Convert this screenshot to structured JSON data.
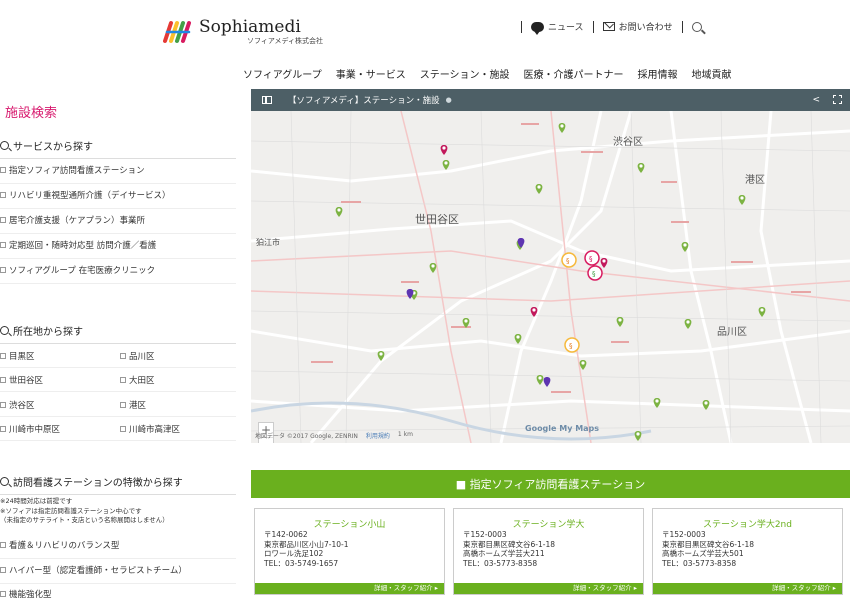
{
  "brand": {
    "name": "Sophiamedi",
    "sub": "ソフィアメディ株式会社"
  },
  "topnav": {
    "news": "ニュース",
    "contact": "お問い合わせ"
  },
  "mainnav": [
    "ソフィアグループ",
    "事業・サービス",
    "ステーション・施設",
    "医療・介護パートナー",
    "採用情報",
    "地域貢献"
  ],
  "sidebar": {
    "title": "施設検索",
    "service_head": "サービスから探す",
    "services": [
      "指定ソフィア訪問看護ステーション",
      "リハビリ重視型通所介護（デイサービス）",
      "居宅介護支援（ケアプラン）事業所",
      "定期巡回・随時対応型 訪問介護／看護",
      "ソフィアグループ 在宅医療クリニック"
    ],
    "area_head": "所在地から探す",
    "areas": [
      "目黒区",
      "品川区",
      "世田谷区",
      "大田区",
      "渋谷区",
      "港区",
      "川崎市中原区",
      "川崎市高津区"
    ],
    "feature_head": "訪問看護ステーションの特徴から探す",
    "notes": [
      "※24時間対応は前提です",
      "※ソフィアは指定訪問看護ステーション中心です",
      "（未指定のサテライト・支店という名称展開はしません）"
    ],
    "features": [
      "看護＆リハビリのバランス型",
      "ハイパー型（認定看護師・セラピストチーム）",
      "機能強化型"
    ]
  },
  "map": {
    "title": "【ソフィアメディ】ステーション・施設",
    "labels": [
      "渋谷区",
      "港区",
      "世田谷区",
      "狛江市",
      "品川区"
    ],
    "zoom_in": "+",
    "zoom_out": "−",
    "attribution": "地図データ ©2017 Google, ZENRIN",
    "terms": "利用規約",
    "scale": "1 km",
    "google": "Google My Maps",
    "colors": {
      "green_pin": "#7cb342",
      "magenta_pin": "#c2185b",
      "purple_pin": "#5e35b1"
    }
  },
  "section": {
    "title": "■ 指定ソフィア訪問看護ステーション"
  },
  "stations": [
    {
      "name": "ステーション小山",
      "lines": [
        "〒142-0062",
        "東京都品川区小山7-10-1",
        "ロワール洗足102",
        "TEL：03-5749-1657"
      ],
      "button": "詳細・スタッフ紹介 ▸"
    },
    {
      "name": "ステーション学大",
      "lines": [
        "〒152-0003",
        "東京都目黒区碑文谷6-1-18",
        "高橋ホームズ学芸大211",
        "TEL：03-5773-8358"
      ],
      "button": "詳細・スタッフ紹介 ▸"
    },
    {
      "name": "ステーション学大2nd",
      "lines": [
        "〒152-0003",
        "東京都目黒区碑文谷6-1-18",
        "高橋ホームズ学芸大501",
        "TEL：03-5773-8358"
      ],
      "button": "詳細・スタッフ紹介 ▸"
    }
  ]
}
